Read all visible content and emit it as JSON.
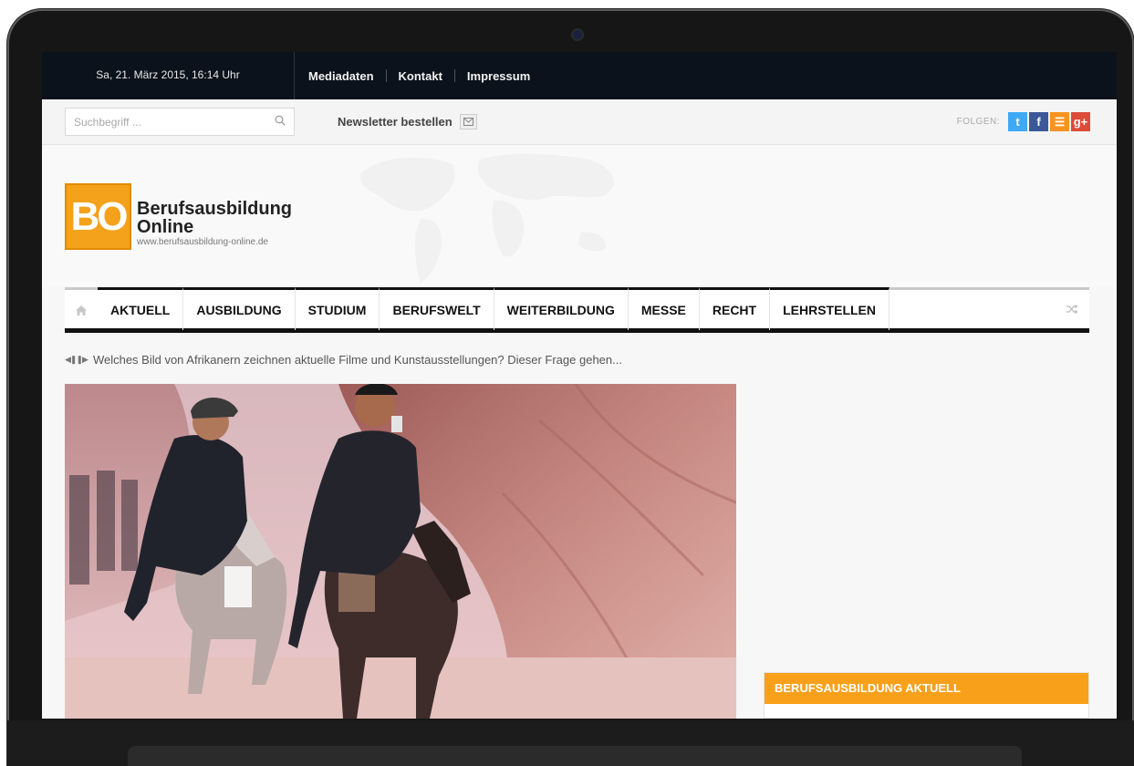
{
  "topbar": {
    "date": "Sa, 21. März 2015, 16:14 Uhr",
    "links": [
      "Mediadaten",
      "Kontakt",
      "Impressum"
    ]
  },
  "search": {
    "placeholder": "Suchbegriff ..."
  },
  "newsletter": {
    "label": "Newsletter bestellen"
  },
  "follow": {
    "label": "FOLGEN:",
    "networks": [
      {
        "icon": "twitter-icon",
        "glyph": "t",
        "color": "#3fa9f5"
      },
      {
        "icon": "facebook-icon",
        "glyph": "f",
        "color": "#3b5998"
      },
      {
        "icon": "rss-icon",
        "glyph": "☰",
        "color": "#f7931e"
      },
      {
        "icon": "google-plus-icon",
        "glyph": "g+",
        "color": "#dd4b39"
      }
    ]
  },
  "logo": {
    "mark": "BO",
    "title_line1": "Berufsausbildung",
    "title_line2": "Online",
    "url": "www.berufsausbildung-online.de",
    "color": "#f4a11b"
  },
  "nav": {
    "items": [
      "AKTUELL",
      "AUSBILDUNG",
      "STUDIUM",
      "BERUFSWELT",
      "WEITERBILDUNG",
      "MESSE",
      "RECHT",
      "LEHRSTELLEN"
    ]
  },
  "ticker": {
    "text": "Welches Bild von Afrikanern zeichnen aktuelle Filme und Kunstausstellungen? Dieser Frage gehen..."
  },
  "sidebar": {
    "box_title": "BERUFSAUSBILDUNG AKTUELL",
    "accent": "#f8a01a"
  }
}
